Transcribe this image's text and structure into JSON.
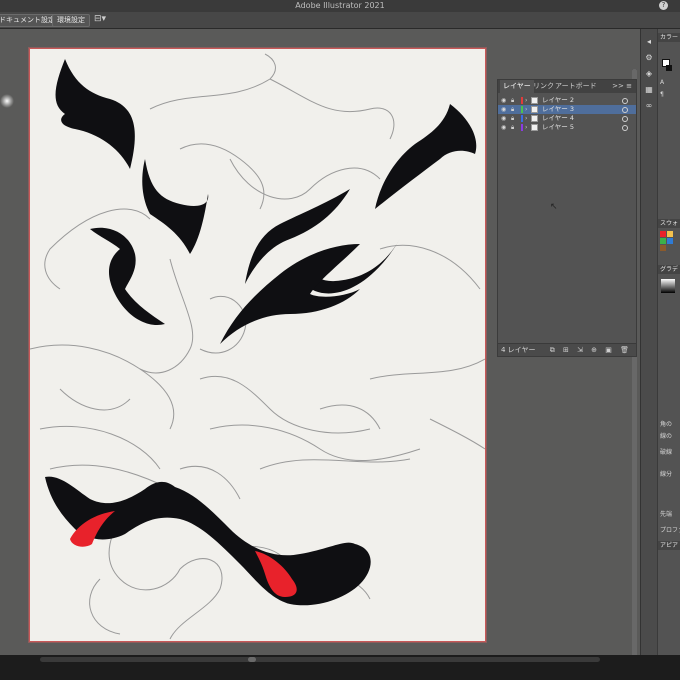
{
  "app": {
    "title": "Adobe Illustrator 2021",
    "help": "?"
  },
  "control_bar": {
    "document_setup": "ドキュメント設定",
    "preferences": "環境設定",
    "arrange_icon": "arrange-documents-icon"
  },
  "layers_panel": {
    "tabs": [
      "レイヤー",
      "リンク",
      "アートボード"
    ],
    "menu": ">> ≡",
    "layers": [
      {
        "name": "レイヤー 2",
        "color": "#e23b3b",
        "selected": false
      },
      {
        "name": "レイヤー 3",
        "color": "#4cc24c",
        "selected": true
      },
      {
        "name": "レイヤー 4",
        "color": "#3b6de2",
        "selected": false
      },
      {
        "name": "レイヤー 5",
        "color": "#8a3be2",
        "selected": false
      }
    ],
    "footer_count": "4 レイヤー",
    "footer_icons": "⧉ ⊞ ⇲ ⊕ ▣ 🗑"
  },
  "right_panel": {
    "color_header": "カラー",
    "swatch_header": "スウォ",
    "gradient_header": "グラデ",
    "appearance_header": "アピア",
    "properties_label": "プロファ",
    "text_items": [
      "角の",
      "線の",
      "破線",
      "線分",
      "先端"
    ]
  },
  "colors": {
    "artboard": "#f1f0ec",
    "ink": "#0f0f12",
    "accent_red": "#e8222b",
    "pencil": "#9a9a9a",
    "selection": "#4f6e9c"
  }
}
